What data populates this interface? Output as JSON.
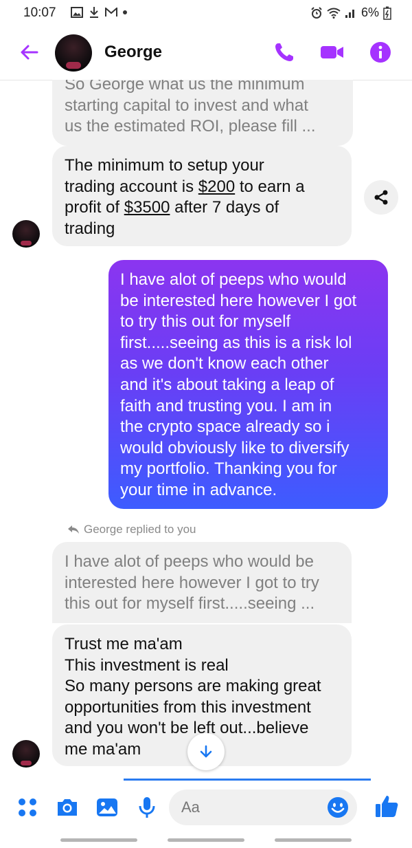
{
  "status": {
    "time": "10:07",
    "battery": "6%"
  },
  "header": {
    "name": "George"
  },
  "messages": {
    "quoted1": [
      "So George what us the minimum",
      "starting capital to invest and what",
      "us the estimated ROI, please fill ..."
    ],
    "reply1": {
      "line1": "The minimum to setup your",
      "line2_pre": "trading account is ",
      "amount1": "$200",
      "line2_post": " to earn a",
      "line3_pre": "profit of ",
      "amount2": "$3500",
      "line3_post": " after 7 days of",
      "line4": "trading"
    },
    "outgoing": [
      "I have alot of peeps who would",
      "be interested here however I got",
      "to try this out for myself",
      "first.....seeing as this is a risk lol",
      "as we don't know each other",
      "and it's about taking a leap of",
      "faith and trusting you. I am in",
      "the crypto space already so i",
      "would obviously like to diversify",
      "my portfolio. Thanking you for",
      "your time in advance."
    ],
    "reply_note": "George replied to you",
    "quoted2": [
      "I have alot of peeps who would be",
      "interested here however I got to try",
      "this out for myself first.....seeing ..."
    ],
    "reply2": [
      "Trust me ma'am",
      "This investment is real",
      "So many persons are making great",
      "opportunities from this investment",
      "and you won't be left out...believe",
      "me ma'am"
    ]
  },
  "composer": {
    "placeholder": "Aa"
  },
  "colors": {
    "accent": "#a533ff",
    "blue": "#1877f2",
    "bubble_in": "#f0f0f0"
  }
}
